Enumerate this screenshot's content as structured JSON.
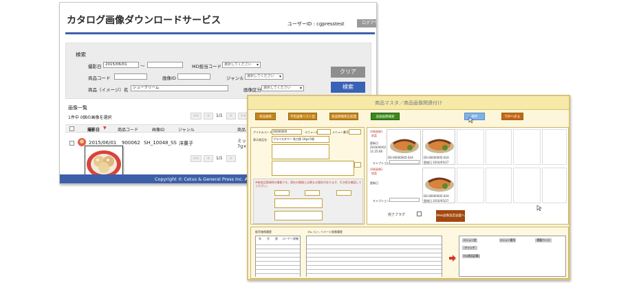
{
  "app": {
    "title": "カタログ画像ダウンロードサービス",
    "user_id": "ユーザーID : cgpresstest",
    "logout": "ログアウト"
  },
  "search": {
    "heading": "検索",
    "date_label": "撮影日",
    "date_from": "2015/06/01",
    "tilde": "〜",
    "md_label": "MD担当コード",
    "select_placeholder": "選択してください",
    "product_code_label": "商品コード",
    "image_id_label": "画像ID",
    "genre_label": "ジャンル",
    "product_name_label": "商品（イメージ）名",
    "product_name_value": "シュークリーム",
    "image_type_label": "画像区分",
    "clear": "クリア",
    "search": "検索"
  },
  "list": {
    "heading": "画像一覧",
    "count": "1件中 0個の画像を選択",
    "page": "1/1",
    "prev2": "<<",
    "prev": "<",
    "next": ">",
    "next2": ">>",
    "columns": [
      "撮影日",
      "商品コード",
      "画像ID",
      "ジャンル",
      "商品"
    ],
    "row": {
      "date": "2015/06/01",
      "product_code": "900062",
      "image_id": "SH_10048_SS",
      "genre": "洋菓子",
      "name_partial": "ミッ",
      "size_partial": "7g×"
    }
  },
  "footer": {
    "copyright": "Copyright © Cetus & General Press Inc. All"
  },
  "master": {
    "title": "商品マスタ／商品画像関連付け",
    "toolbar": [
      {
        "label": "商品検索",
        "color": "#c8841c"
      },
      {
        "label": "不足画像リスト出力",
        "color": "#c8841c"
      },
      {
        "label": "商品情報修正処理",
        "color": "#c8841c"
      },
      {
        "label": "追加画像検索",
        "color": "#3c8a1c"
      },
      {
        "label": "保存",
        "color": "#7fb2e6"
      },
      {
        "label": "TOPへ戻る",
        "color": "#c86418"
      }
    ],
    "item_code_label": "アイテムコード",
    "item_code": "00000000",
    "menu_label": "メニュー名",
    "menu_no_label": "メニュー番号",
    "display_name_label": "表示商品名",
    "display_name": "プライスタワー 秋刀魚 16g×5袋",
    "notice": "※新商品登録時の情報です。現在の情報とは異なる場合があります、引き続き確認してください。",
    "image1_label": "印刷画像1",
    "image1_sub": "前菜",
    "image2_label": "印刷画像2",
    "image2_sub": "惣菜",
    "update_label": "更新日",
    "update_date": "2016/06/02",
    "update_time": "11:25:08",
    "caption_label": "キャプション",
    "img_code1": "DS-00000005-02A",
    "img_code2": "DS-00000005-02A",
    "reg_label": "登録日",
    "reg_date": "2016/05/27",
    "kanryo": "完了フラグ",
    "web_btn": "Web画像設定画面へ",
    "history_label": "販売価格履歴",
    "grid_label": "ｺﾗﾑ, ﾒﾆｭｰ, イメージ画像履歴",
    "menu_name_btn": "メニュー名",
    "menu_no_h": "メニュー番号",
    "page_h": "掲載ページ",
    "caption_btn": "キャッチ",
    "column_btn": "ｺﾗﾑ(商品記事)",
    "row_head": [
      "年",
      "号",
      "頁",
      "コーナー詳細"
    ]
  }
}
